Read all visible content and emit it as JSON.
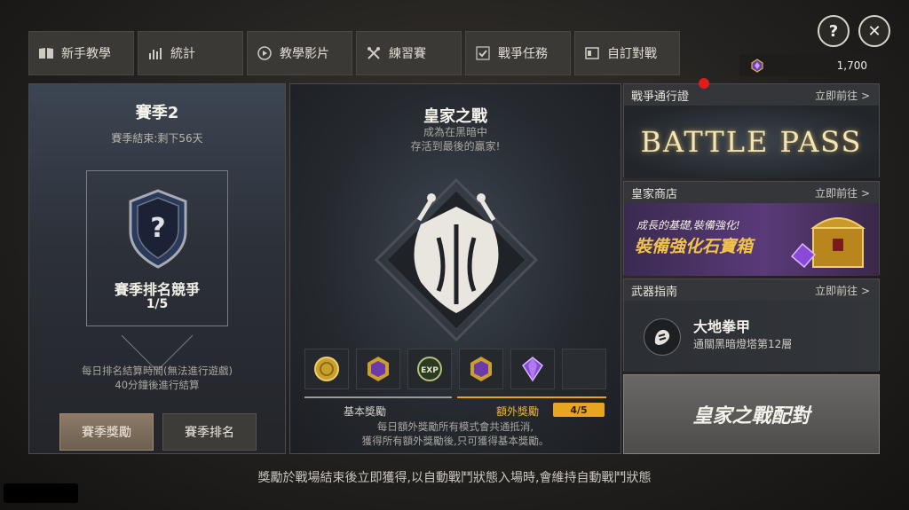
{
  "tabs": [
    {
      "label": "新手教學",
      "icon": "book-icon"
    },
    {
      "label": "統計",
      "icon": "bar-chart-icon"
    },
    {
      "label": "教學影片",
      "icon": "play-icon"
    },
    {
      "label": "練習賽",
      "icon": "tools-icon"
    },
    {
      "label": "戰爭任務",
      "icon": "check-icon"
    },
    {
      "label": "自訂對戰",
      "icon": "square-icon"
    }
  ],
  "top_buttons": {
    "help": "?",
    "close": "✕"
  },
  "currency": {
    "icon": "gem-icon",
    "amount": "1,700"
  },
  "season_panel": {
    "title": "賽季2",
    "subtitle": "賽季結束:剩下56天",
    "rank_title": "賽季排名競爭",
    "rank_count": "1/5",
    "note_line1": "每日排名結算時間(無法進行遊戲)",
    "note_line2": "40分鐘後進行結算",
    "reward_button": "賽季獎勵",
    "ranking_button": "賽季排名"
  },
  "royal_panel": {
    "title": "皇家之戰",
    "desc_line1": "成為在黑暗中",
    "desc_line2": "存活到最後的贏家!",
    "rewards": [
      "gold-coin-icon",
      "purple-medal-icon",
      "exp-icon",
      "purple-medal-icon",
      "purple-crystal-icon",
      "empty-slot"
    ],
    "exp_text": "EXP",
    "basic_label": "基本獎勵",
    "extra_label": "額外獎勵",
    "extra_count": "4/5",
    "foot_line1": "每日額外獎勵所有模式會共通抵消,",
    "foot_line2": "獲得所有額外獎勵後,只可獲得基本獎勵。"
  },
  "side": {
    "battle_pass": {
      "header": "戰爭通行證",
      "go": "立即前往 >",
      "banner": "BATTLE PASS"
    },
    "shop": {
      "header": "皇家商店",
      "go": "立即前往 >",
      "line1": "成長的基礎,裝備強化!",
      "line2": "裝備強化石寶箱"
    },
    "weapon": {
      "header": "武器指南",
      "go": "立即前往 >",
      "name": "大地拳甲",
      "desc": "通關黑暗燈塔第12層"
    },
    "match_button": "皇家之戰配對"
  },
  "bottom_note": "獎勵於戰場結束後立即獲得,以自動戰鬥狀態入場時,會維持自動戰鬥狀態",
  "colors": {
    "accent": "#e8a520",
    "notify": "#e01c1c",
    "gold_text": "#f2c34a"
  }
}
